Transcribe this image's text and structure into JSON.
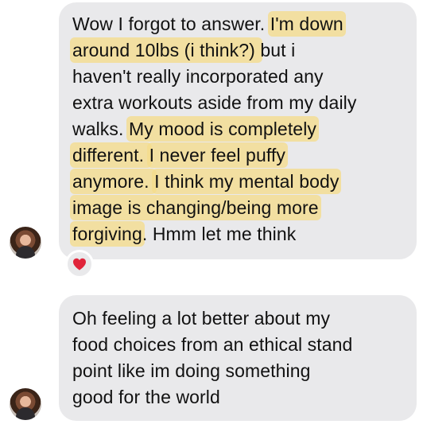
{
  "messages": [
    {
      "lines": [
        [
          {
            "t": "Wow I forgot to answer. "
          },
          {
            "t": "I'm down",
            "hl": true
          }
        ],
        [
          {
            "t": "around 10lbs (i think?) ",
            "hl": true
          },
          {
            "t": "but i"
          }
        ],
        [
          {
            "t": "haven't really incorporated any"
          }
        ],
        [
          {
            "t": "extra workouts aside from my daily"
          }
        ],
        [
          {
            "t": "walks. "
          },
          {
            "t": "My mood is completely",
            "hl": true
          }
        ],
        [
          {
            "t": "different. ",
            "hl": true
          },
          {
            "t": "I never feel puffy",
            "hl": true
          }
        ],
        [
          {
            "t": "anymore. ",
            "hl": true
          },
          {
            "t": "I think my mental body",
            "hl": true
          }
        ],
        [
          {
            "t": "image is changing/being more",
            "hl": true
          }
        ],
        [
          {
            "t": "forgiving",
            "hl": true
          },
          {
            "t": ". Hmm let me think"
          }
        ]
      ],
      "reaction": "heart-icon",
      "reaction_color": "#e0243a"
    },
    {
      "lines": [
        [
          {
            "t": "Oh feeling a lot better about my"
          }
        ],
        [
          {
            "t": "food choices from an ethical stand"
          }
        ],
        [
          {
            "t": "point like im doing something"
          }
        ],
        [
          {
            "t": "good for the world"
          }
        ]
      ]
    }
  ],
  "colors": {
    "bubble": "#e9e9eb",
    "highlight": "#f5dd8c",
    "text": "#111111"
  }
}
